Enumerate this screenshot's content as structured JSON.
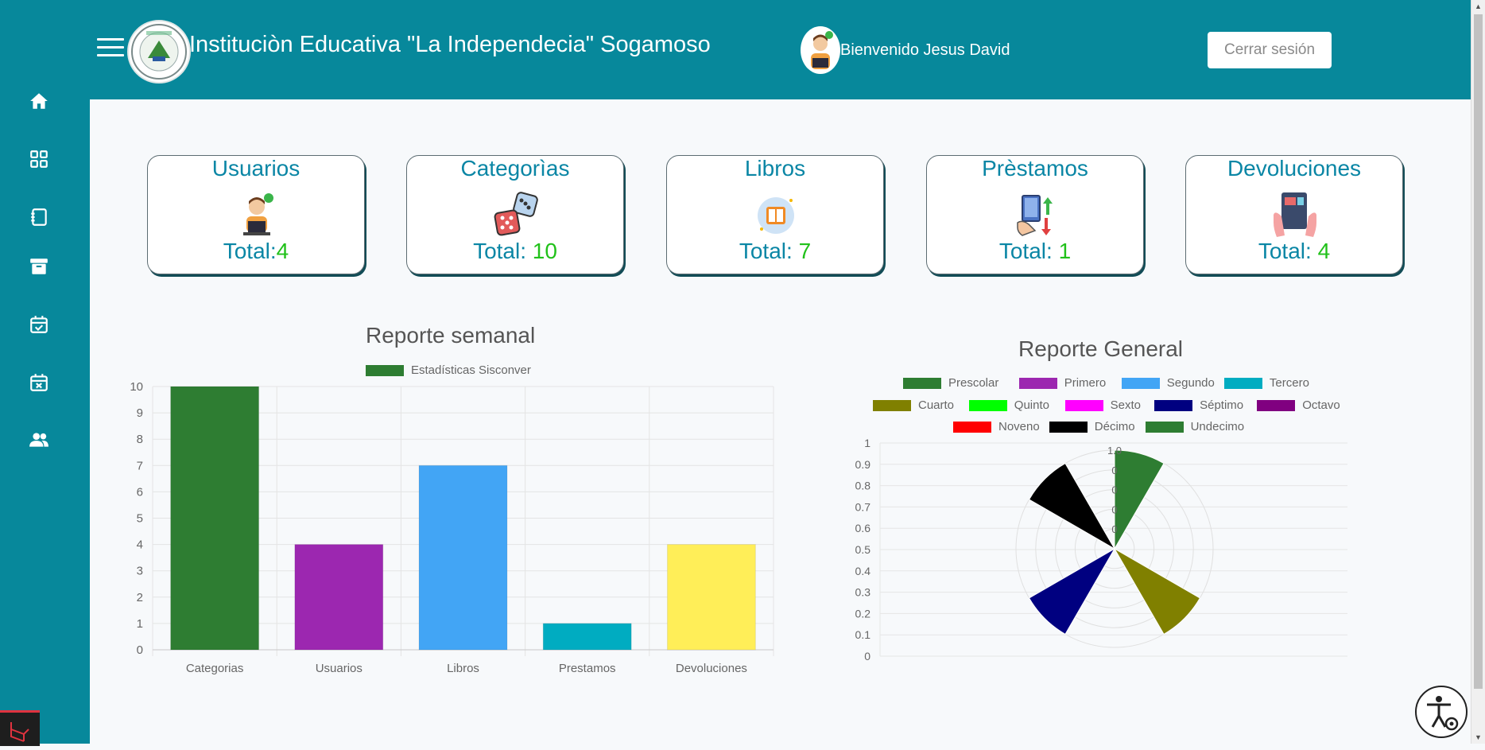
{
  "header": {
    "title": "Instituciòn Educativa \"La Independecia\" Sogamoso",
    "welcome": "Bienvenido Jesus David",
    "logout_label": "Cerrar sesión"
  },
  "sidebar": {
    "items": [
      {
        "icon": "home-icon"
      },
      {
        "icon": "grid-icon"
      },
      {
        "icon": "book-icon"
      },
      {
        "icon": "archive-icon"
      },
      {
        "icon": "calendar-check-icon"
      },
      {
        "icon": "calendar-x-icon"
      },
      {
        "icon": "users-icon"
      }
    ]
  },
  "cards": [
    {
      "title": "Usuarios",
      "total_label": "Total:",
      "total_value": "4"
    },
    {
      "title": "Categorìas",
      "total_label": "Total: ",
      "total_value": "10"
    },
    {
      "title": "Libros",
      "total_label": "Total: ",
      "total_value": "7"
    },
    {
      "title": "Prèstamos",
      "total_label": "Total: ",
      "total_value": "1"
    },
    {
      "title": "Devoluciones",
      "total_label": "Total: ",
      "total_value": "4"
    }
  ],
  "chart_data": [
    {
      "type": "bar",
      "title": "Reporte semanal",
      "legend": "Estadísticas Sisconver",
      "categories": [
        "Categorias",
        "Usuarios",
        "Libros",
        "Prestamos",
        "Devoluciones"
      ],
      "values": [
        10,
        4,
        7,
        1,
        4
      ],
      "colors": [
        "#2e7d32",
        "#9c27b0",
        "#42a5f5",
        "#00acc1",
        "#ffee58"
      ],
      "ylim": [
        0,
        10
      ],
      "yticks": [
        "0",
        "1",
        "2",
        "3",
        "4",
        "5",
        "6",
        "7",
        "8",
        "9",
        "10"
      ],
      "grid": true,
      "legend_position": "top"
    },
    {
      "type": "polarArea",
      "title": "Reporte General",
      "labels": [
        "Prescolar",
        "Primero",
        "Segundo",
        "Tercero",
        "Cuarto",
        "Quinto",
        "Sexto",
        "Séptimo",
        "Octavo",
        "Noveno",
        "Décimo",
        "Undecimo"
      ],
      "colors": [
        "#2e7d32",
        "#9c27b0",
        "#42a5f5",
        "#00acc1",
        "#808000",
        "#00ff00",
        "#ff00ff",
        "#000080",
        "#800080",
        "#ff0000",
        "#000000",
        "#2e7d32"
      ],
      "values": [
        1,
        0,
        0,
        0,
        1,
        0,
        0,
        1,
        0,
        0,
        1,
        0
      ],
      "yticks": [
        "0",
        "0.1",
        "0.2",
        "0.3",
        "0.4",
        "0.5",
        "0.6",
        "0.7",
        "0.8",
        "0.9",
        "1"
      ],
      "radial_ticks": [
        "1.0",
        "0",
        "0",
        "0",
        "0"
      ],
      "legend_position": "top"
    }
  ]
}
